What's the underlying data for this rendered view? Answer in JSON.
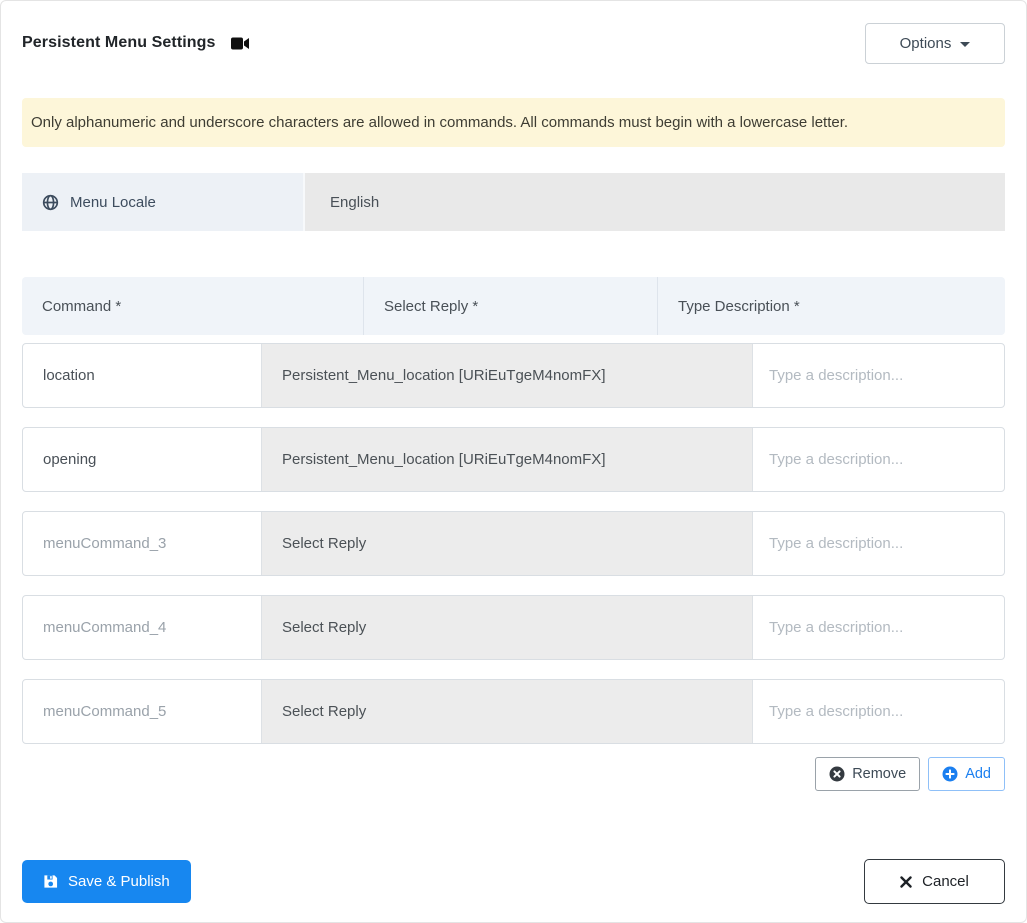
{
  "header": {
    "title": "Persistent Menu Settings",
    "options_button": "Options"
  },
  "alert": {
    "text": "Only alphanumeric and underscore characters are allowed in commands. All commands must begin with a lowercase letter."
  },
  "locale": {
    "label": "Menu Locale",
    "value": "English"
  },
  "commands_table": {
    "headers": {
      "command": "Command *",
      "reply": "Select Reply *",
      "description": "Type Description *"
    },
    "rows": [
      {
        "command_value": "location",
        "command_placeholder": "",
        "reply": "Persistent_Menu_location [URiEuTgeM4nomFX]",
        "description_value": "",
        "description_placeholder": "Type a description..."
      },
      {
        "command_value": "opening",
        "command_placeholder": "",
        "reply": "Persistent_Menu_location [URiEuTgeM4nomFX]",
        "description_value": "",
        "description_placeholder": "Type a description..."
      },
      {
        "command_value": "",
        "command_placeholder": "menuCommand_3",
        "reply": "Select Reply",
        "description_value": "",
        "description_placeholder": "Type a description..."
      },
      {
        "command_value": "",
        "command_placeholder": "menuCommand_4",
        "reply": "Select Reply",
        "description_value": "",
        "description_placeholder": "Type a description..."
      },
      {
        "command_value": "",
        "command_placeholder": "menuCommand_5",
        "reply": "Select Reply",
        "description_value": "",
        "description_placeholder": "Type a description..."
      }
    ],
    "remove_button": "Remove",
    "add_button": "Add"
  },
  "footer": {
    "save_button": "Save & Publish",
    "cancel_button": "Cancel"
  },
  "icons": {
    "title_icon": "videocam-icon",
    "locale_icon": "globe-icon",
    "remove_icon": "times-circle-icon",
    "add_icon": "plus-circle-icon",
    "save_icon": "floppy-disk-icon",
    "cancel_icon": "x-icon"
  },
  "colors": {
    "primary_blue": "#1787f0",
    "add_blue": "#1b7ff0",
    "alert_bg": "#fdf6d9",
    "table_header_bg": "#f0f4f9",
    "locale_label_bg": "#edf1f6",
    "locale_value_bg": "#e9e9e9",
    "select_reply_bg": "#ececec",
    "dark_text": "#495057",
    "placeholder_text": "#9aa2aa",
    "cancel_border": "#343a40"
  }
}
